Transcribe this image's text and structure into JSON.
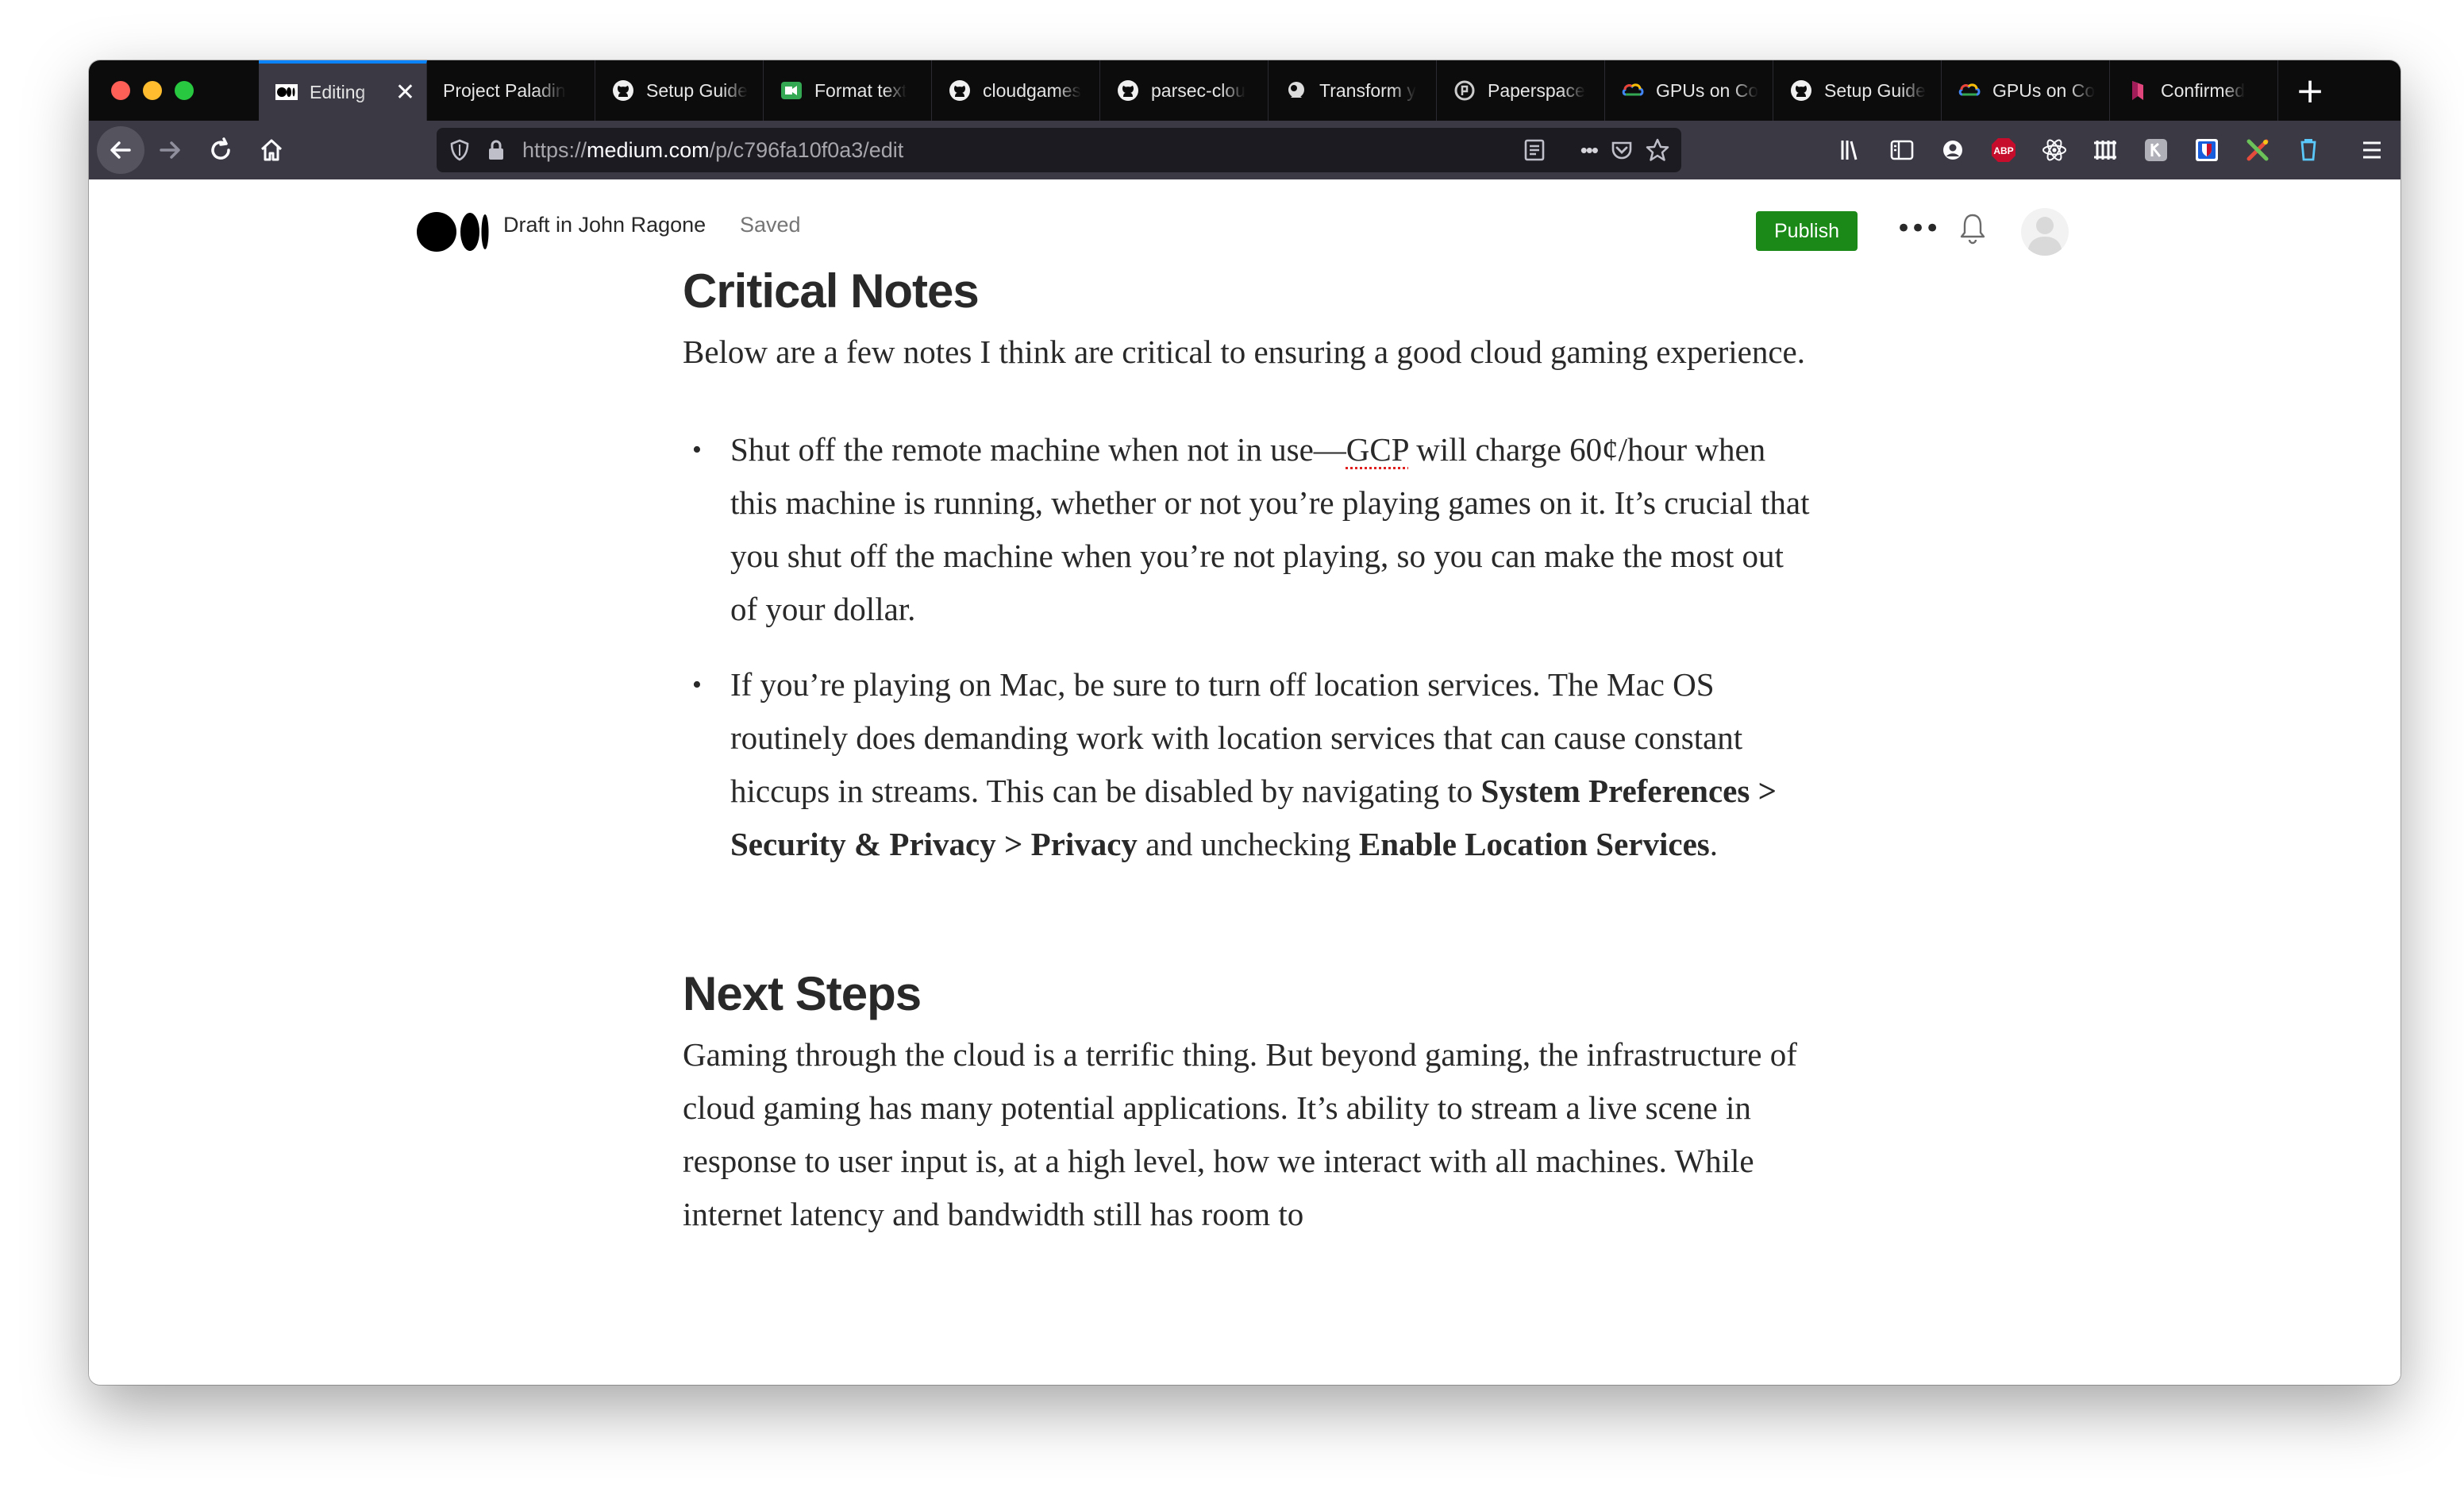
{
  "browser": {
    "tabs": [
      {
        "title": "Editing",
        "icon": "medium-logo-icon",
        "active": true,
        "close": "✕"
      },
      {
        "title": "Project Paladin",
        "icon": "",
        "active": false
      },
      {
        "title": "Setup Guide",
        "icon": "github-icon",
        "active": false
      },
      {
        "title": "Format text",
        "icon": "meet-icon",
        "active": false
      },
      {
        "title": "cloudgames",
        "icon": "github-icon",
        "active": false
      },
      {
        "title": "parsec-clou",
        "icon": "github-icon",
        "active": false
      },
      {
        "title": "Transform y",
        "icon": "cloud-icon",
        "active": false
      },
      {
        "title": "Paperspace",
        "icon": "paperspace-icon",
        "active": false
      },
      {
        "title": "GPUs on Co",
        "icon": "google-cloud-icon",
        "active": false
      },
      {
        "title": "Setup Guide",
        "icon": "github-icon",
        "active": false
      },
      {
        "title": "GPUs on Co",
        "icon": "google-cloud-icon",
        "active": false
      },
      {
        "title": "Confirmed",
        "icon": "bookmark-icon",
        "active": false
      }
    ],
    "new_tab": "+",
    "url": {
      "scheme": "https://",
      "host": "medium.com",
      "path": "/p/c796fa10f0a3/edit"
    },
    "more_actions": "•••",
    "extensions": {
      "abp": "ABP"
    },
    "colors": {
      "tab_strip": "#0c0c0d",
      "toolbar": "#3a3944",
      "urlbar": "#1c1b22",
      "active_tab_accent": "#0a84ff"
    }
  },
  "editor": {
    "draft_label": "Draft in John Ragone",
    "saved_label": "Saved",
    "publish_label": "Publish",
    "more_label": "•••",
    "publish_color": "#1a8917"
  },
  "article": {
    "section1": {
      "heading": "Critical Notes",
      "intro": "Below are a few notes I think are critical to ensuring a good cloud gaming experience.",
      "bullet1": {
        "before": "Shut off the remote machine when not in use—",
        "misspelled": "GCP",
        "after": " will charge 60¢/hour when this machine is running, whether or not you’re playing games on it. It’s crucial that you shut off the machine when you’re not playing, so you can make the most out of your dollar."
      },
      "bullet2": {
        "text1": "If you’re playing on Mac, be sure to turn off location services. The Mac OS routinely does demanding work with location services that can cause constant hiccups in streams. This can be disabled by navigating to ",
        "bold1": "System Preferences > Security & Privacy > Privacy",
        "text2": " and unchecking ",
        "bold2": "Enable Location Services",
        "text3": "."
      }
    },
    "section2": {
      "heading": "Next Steps",
      "body": "Gaming through the cloud is a terrific thing. But beyond gaming, the infrastructure of cloud gaming has many potential applications. It’s ability to stream a live scene in response to user input is, at a high level, how we interact with all machines. While internet latency and bandwidth still has room to"
    }
  }
}
